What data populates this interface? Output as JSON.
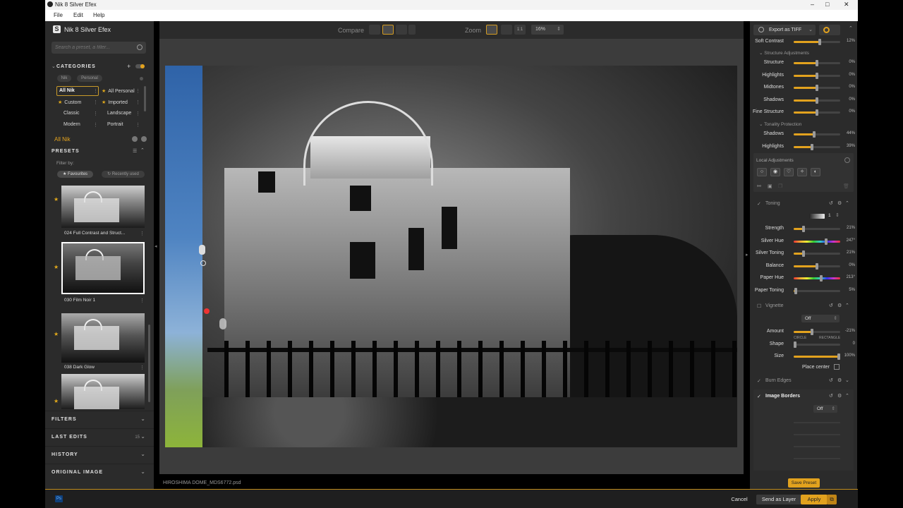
{
  "window": {
    "title": "Nik 8 Silver Efex",
    "controls": [
      "–",
      "□",
      "✕"
    ]
  },
  "menu": [
    "File",
    "Edit",
    "Help"
  ],
  "left": {
    "brand": "Nik 8 Silver Efex",
    "search_placeholder": "Search a preset, a filter...",
    "categories_header": "CATEGORIES",
    "category_tabs": [
      "Nik",
      "Personal"
    ],
    "categories": [
      {
        "label": "All Nik",
        "starred": false,
        "selected": true
      },
      {
        "label": "All Personal",
        "starred": true
      },
      {
        "label": "Custom",
        "starred": true
      },
      {
        "label": "Imported",
        "starred": true
      },
      {
        "label": "Classic",
        "starred": false
      },
      {
        "label": "Landscape",
        "starred": false
      },
      {
        "label": "Modern",
        "starred": false
      },
      {
        "label": "Portrait",
        "starred": false
      }
    ],
    "current_category": "All Nik",
    "presets_header": "PRESETS",
    "filter_by": "Filter by:",
    "filter_favourites": "Favourites",
    "filter_recent": "Recently used",
    "presets": [
      {
        "name": "024 Full Contrast and Struct...",
        "favourite": true,
        "selected": false
      },
      {
        "name": "030 Film Noir 1",
        "favourite": true,
        "selected": true
      },
      {
        "name": "038 Dark Glow",
        "favourite": true,
        "selected": false
      },
      {
        "name": "",
        "favourite": true,
        "selected": false
      }
    ],
    "sections": [
      {
        "label": "FILTERS",
        "count": ""
      },
      {
        "label": "LAST EDITS",
        "count": "15"
      },
      {
        "label": "HISTORY",
        "count": ""
      },
      {
        "label": "ORIGINAL IMAGE",
        "count": ""
      }
    ]
  },
  "toolbar": {
    "compare": "Compare",
    "zoom": "Zoom",
    "zoom_1to1": "1:1",
    "zoom_value": "16%"
  },
  "file_name": "HIROSHIMA DOME_MDS6772.psd",
  "right": {
    "export_label": "Export as TIFF",
    "soft_contrast": {
      "label": "Soft Contrast",
      "value": "12%",
      "level": 0.56
    },
    "structure_header": "Structure Adjustments",
    "structure": [
      {
        "label": "Structure",
        "value": "0%",
        "level": 0.5
      },
      {
        "label": "Highlights",
        "value": "0%",
        "level": 0.5
      },
      {
        "label": "Midtones",
        "value": "0%",
        "level": 0.5
      },
      {
        "label": "Shadows",
        "value": "0%",
        "level": 0.5
      },
      {
        "label": "Fine Structure",
        "value": "0%",
        "level": 0.5
      }
    ],
    "tonality_header": "Tonality Protection",
    "tonality": [
      {
        "label": "Shadows",
        "value": "44%",
        "level": 0.44
      },
      {
        "label": "Highlights",
        "value": "39%",
        "level": 0.39
      }
    ],
    "local_adjustments": "Local Adjustments",
    "toning": {
      "header": "Toning",
      "preset_number": "1",
      "rows": [
        {
          "label": "Strength",
          "value": "21%",
          "level": 0.21,
          "rainbow": false
        },
        {
          "label": "Silver Hue",
          "value": "247°",
          "level": 0.69,
          "rainbow": true
        },
        {
          "label": "Silver Toning",
          "value": "21%",
          "level": 0.21,
          "rainbow": false
        },
        {
          "label": "Balance",
          "value": "0%",
          "level": 0.5,
          "rainbow": false
        },
        {
          "label": "Paper Hue",
          "value": "213°",
          "level": 0.59,
          "rainbow": true
        },
        {
          "label": "Paper Toning",
          "value": "5%",
          "level": 0.05,
          "rainbow": false
        }
      ]
    },
    "vignette": {
      "header": "Vignette",
      "mode": "Off",
      "amount_label": "Amount",
      "amount_value": "-21%",
      "amount_level": 0.4,
      "shape_label": "Shape",
      "shape_value": "0",
      "shape_left": "CIRCLE",
      "shape_right": "RECTANGLE",
      "size_label": "Size",
      "size_value": "100%",
      "size_level": 1.0,
      "place_center": "Place center"
    },
    "burn_edges": "Burn Edges",
    "image_borders": {
      "header": "Image Borders",
      "mode": "Off"
    },
    "save_preset": "Save Preset"
  },
  "bottom": {
    "ps": "Ps",
    "cancel": "Cancel",
    "send_as_layer": "Send as Layer",
    "apply": "Apply"
  },
  "colors": {
    "accent": "#e2a21e",
    "panel": "#2b2b2b",
    "canvas": "#3c3c3c"
  }
}
